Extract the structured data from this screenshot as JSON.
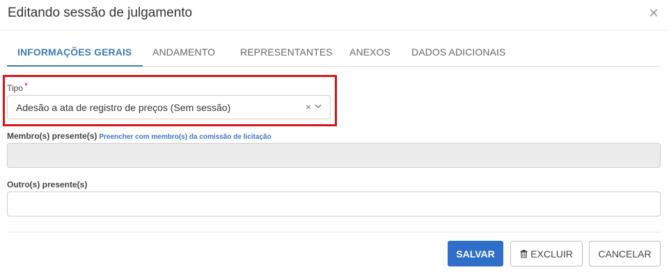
{
  "dialog": {
    "title": "Editando sessão de julgamento",
    "close_icon": "close-icon"
  },
  "tabs": [
    {
      "label": "INFORMAÇÕES GERAIS",
      "active": true
    },
    {
      "label": "ANDAMENTO",
      "active": false
    },
    {
      "label": "REPRESENTANTES",
      "active": false
    },
    {
      "label": "ANEXOS",
      "active": false
    },
    {
      "label": "DADOS ADICIONAIS",
      "active": false
    }
  ],
  "form": {
    "tipo": {
      "label": "Tipo",
      "required_mark": "*",
      "value": "Adesão a ata de registro de preços (Sem sessão)",
      "clear_glyph": "×"
    },
    "membros": {
      "label": "Membro(s) presente(s)",
      "link": "Preencher com membro(s) da comissão de licitação",
      "value": ""
    },
    "outros": {
      "label": "Outro(s) presente(s)",
      "value": ""
    }
  },
  "actions": {
    "save": "SALVAR",
    "delete": "EXCLUIR",
    "cancel": "CANCELAR"
  },
  "colors": {
    "accent": "#3e7bb4",
    "primary_button": "#2f6fc9",
    "highlight_border": "#d7141a",
    "required": "#d7141a"
  }
}
